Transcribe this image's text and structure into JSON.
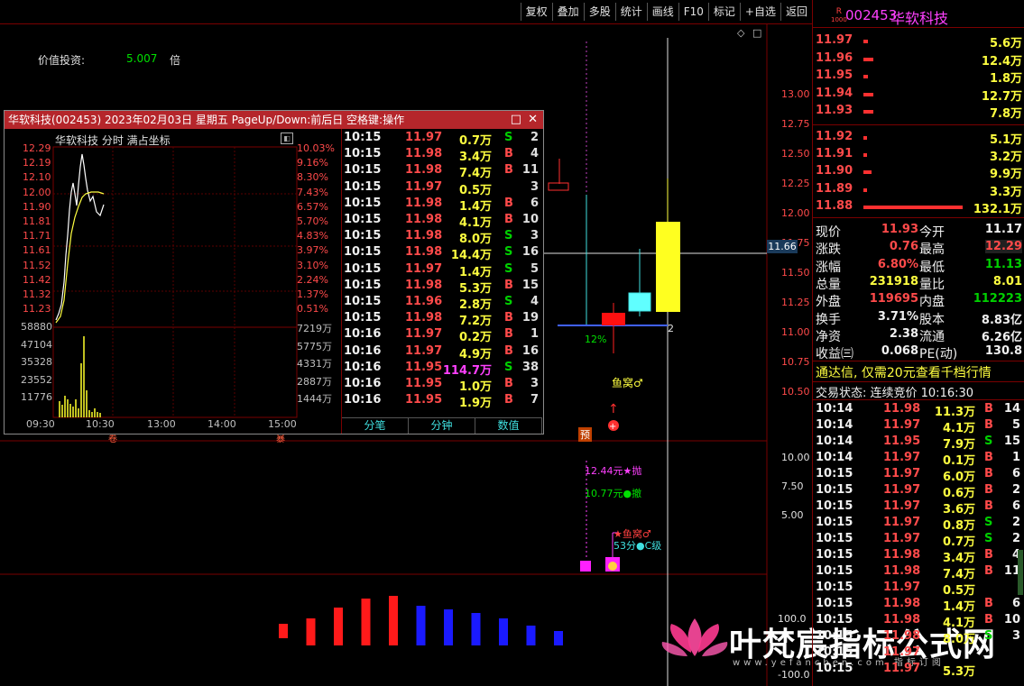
{
  "toolbar": {
    "buttons": [
      "复权",
      "叠加",
      "多股",
      "统计",
      "画线",
      "F10",
      "标记",
      "+自选",
      "返回"
    ]
  },
  "stock": {
    "code": "002453",
    "name": "华软科技",
    "badge_top": "R",
    "badge_bottom": "1000"
  },
  "indicator": {
    "label": "价值投资:",
    "value": "5.007",
    "unit": "倍"
  },
  "main_axis": [
    "13.00",
    "12.75",
    "12.50",
    "12.25",
    "12.00",
    "11.75",
    "11.50",
    "11.25",
    "11.00",
    "10.75",
    "10.50"
  ],
  "cursor_price": "11.66",
  "chart_labels": {
    "pct": "12%",
    "count": "2",
    "yuwo": "鱼窝♂",
    "yu_tag": "预",
    "left_tag1": "卷",
    "left_tag2": "暴"
  },
  "sub_axis": [
    "10.00",
    "7.50",
    "5.00"
  ],
  "sub_labels": {
    "sell": "12.44元★抛",
    "cancel": "10.77元●撤",
    "yuwo2": "★鱼窝♂",
    "grade": "53分●C级"
  },
  "macd_axis": [
    "100.0",
    "-100.0"
  ],
  "macd_values": [
    -18,
    30,
    42,
    52,
    55,
    44,
    40,
    36,
    30,
    22,
    16
  ],
  "macd_colors": [
    "#ff1a1a",
    "#ff1a1a",
    "#ff1a1a",
    "#ff1a1a",
    "#ff1a1a",
    "#1a1aff",
    "#1a1aff",
    "#1a1aff",
    "#1a1aff",
    "#1a1aff",
    "#1a1aff"
  ],
  "popup": {
    "title": "华软科技(002453) 2023年02月03日 星期五 PageUp/Down:前后日 空格键:操作",
    "chart_title": "华软科技  分时  满占坐标",
    "left_axis": [
      "12.29",
      "12.19",
      "12.10",
      "12.00",
      "11.90",
      "11.81",
      "11.71",
      "11.61",
      "11.52",
      "11.42",
      "11.32",
      "11.23"
    ],
    "right_axis": [
      "10.03%",
      "9.16%",
      "8.30%",
      "7.43%",
      "6.57%",
      "5.70%",
      "4.83%",
      "3.97%",
      "3.10%",
      "2.24%",
      "1.37%",
      "0.51%"
    ],
    "vol_left": [
      "58880",
      "47104",
      "35328",
      "23552",
      "11776"
    ],
    "vol_right": [
      "7219万",
      "5775万",
      "4331万",
      "2887万",
      "1444万"
    ],
    "times": [
      "09:30",
      "10:30",
      "13:00",
      "14:00",
      "15:00"
    ],
    "ticks": [
      [
        "10:15",
        "11.97",
        "0.7万",
        "S",
        "2"
      ],
      [
        "10:15",
        "11.98",
        "3.4万",
        "B",
        "4"
      ],
      [
        "10:15",
        "11.98",
        "7.4万",
        "B",
        "11"
      ],
      [
        "10:15",
        "11.97",
        "0.5万",
        "",
        "3"
      ],
      [
        "10:15",
        "11.98",
        "1.4万",
        "B",
        "6"
      ],
      [
        "10:15",
        "11.98",
        "4.1万",
        "B",
        "10"
      ],
      [
        "10:15",
        "11.98",
        "8.0万",
        "S",
        "3"
      ],
      [
        "10:15",
        "11.98",
        "14.4万",
        "S",
        "16"
      ],
      [
        "10:15",
        "11.97",
        "1.4万",
        "S",
        "5"
      ],
      [
        "10:15",
        "11.98",
        "5.3万",
        "B",
        "15"
      ],
      [
        "10:15",
        "11.96",
        "2.8万",
        "S",
        "4"
      ],
      [
        "10:15",
        "11.98",
        "7.2万",
        "B",
        "19"
      ],
      [
        "10:16",
        "11.97",
        "0.2万",
        "B",
        "1"
      ],
      [
        "10:16",
        "11.97",
        "4.9万",
        "B",
        "16"
      ],
      [
        "10:16",
        "11.95",
        "114.7万",
        "S",
        "38"
      ],
      [
        "10:16",
        "11.95",
        "1.0万",
        "B",
        "3"
      ],
      [
        "10:16",
        "11.95",
        "1.9万",
        "B",
        "7"
      ]
    ],
    "tabs": [
      "分笔",
      "分钟",
      "数值"
    ]
  },
  "orderbook": {
    "asks": [
      [
        "11.97",
        "5.6万"
      ],
      [
        "11.96",
        "12.4万"
      ],
      [
        "11.95",
        "1.8万"
      ],
      [
        "11.94",
        "12.7万"
      ],
      [
        "11.93",
        "7.8万"
      ]
    ],
    "bids": [
      [
        "11.92",
        "5.1万"
      ],
      [
        "11.91",
        "3.2万"
      ],
      [
        "11.90",
        "9.9万"
      ],
      [
        "11.89",
        "3.3万"
      ],
      [
        "11.88",
        "132.1万"
      ]
    ]
  },
  "quote": [
    [
      "现价",
      "11.93",
      "今开",
      "11.17"
    ],
    [
      "涨跌",
      "0.76",
      "最高",
      "12.29"
    ],
    [
      "涨幅",
      "6.80%",
      "最低",
      "11.13"
    ],
    [
      "总量",
      "231918",
      "量比",
      "8.01"
    ],
    [
      "外盘",
      "119695",
      "内盘",
      "112223"
    ],
    [
      "换手",
      "3.71%",
      "股本",
      "8.83亿"
    ],
    [
      "净资",
      "2.38",
      "流通",
      "6.26亿"
    ],
    [
      "收益㈢",
      "0.068",
      "PE(动)",
      "130.8"
    ]
  ],
  "promo": "通达信, 仅需20元查看千档行情",
  "trade_status": "交易状态: 连续竞价 10:16:30",
  "trades": [
    [
      "10:14",
      "11.98",
      "11.3万",
      "B",
      "14"
    ],
    [
      "10:14",
      "11.97",
      "4.1万",
      "B",
      "5"
    ],
    [
      "10:14",
      "11.95",
      "7.9万",
      "S",
      "15"
    ],
    [
      "10:14",
      "11.97",
      "0.1万",
      "B",
      "1"
    ],
    [
      "10:15",
      "11.97",
      "6.0万",
      "B",
      "6"
    ],
    [
      "10:15",
      "11.97",
      "0.6万",
      "B",
      "2"
    ],
    [
      "10:15",
      "11.97",
      "3.6万",
      "B",
      "6"
    ],
    [
      "10:15",
      "11.97",
      "0.8万",
      "S",
      "2"
    ],
    [
      "10:15",
      "11.97",
      "0.7万",
      "S",
      "2"
    ],
    [
      "10:15",
      "11.98",
      "3.4万",
      "B",
      "4"
    ],
    [
      "10:15",
      "11.98",
      "7.4万",
      "B",
      "11"
    ],
    [
      "10:15",
      "11.97",
      "0.5万",
      "",
      ""
    ],
    [
      "10:15",
      "11.98",
      "1.4万",
      "B",
      "6"
    ],
    [
      "10:15",
      "11.98",
      "4.1万",
      "B",
      "10"
    ],
    [
      "10:15",
      "11.98",
      "8.0万",
      "S",
      "3"
    ],
    [
      "10:15",
      "11.97",
      "",
      "",
      ""
    ],
    [
      "10:15",
      "11.97",
      "5.3万",
      "",
      ""
    ]
  ],
  "watermark": {
    "main": "叶梵宸指标公式网",
    "sub": "www.yefanchen.com    指标订阅"
  }
}
